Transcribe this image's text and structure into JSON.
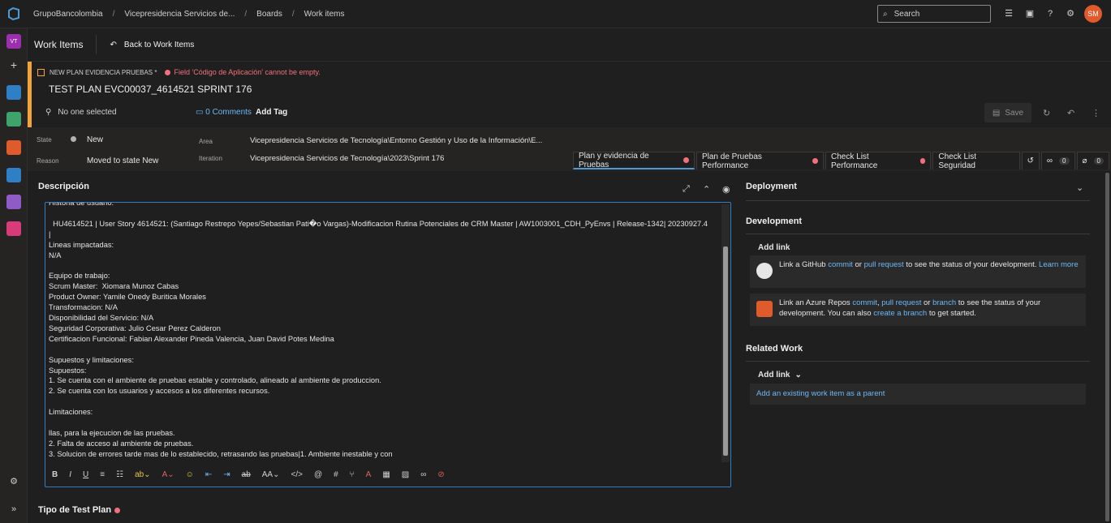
{
  "topbar": {
    "breadcrumbs": [
      "GrupoBancolombia",
      "Vicepresidencia Servicios de...",
      "Boards",
      "Work items"
    ],
    "search_placeholder": "Search",
    "avatar_initials": "SM"
  },
  "leftnav": {
    "project_initials": "VT"
  },
  "header": {
    "title": "Work Items",
    "back_label": "Back to Work Items"
  },
  "workitem": {
    "type_label": "NEW PLAN EVIDENCIA PRUEBAS *",
    "error": "Field 'Código de Aplicación' cannot be empty.",
    "title": "TEST PLAN EVC00037_4614521 SPRINT 176",
    "assigned": "No one selected",
    "comments": "0 Comments",
    "add_tag": "Add Tag",
    "save": "Save"
  },
  "fields": {
    "state_label": "State",
    "state_value": "New",
    "reason_label": "Reason",
    "reason_value": "Moved to state New",
    "area_label": "Area",
    "area_value": "Vicepresidencia Servicios de Tecnología\\Entorno Gestión y Uso de la Información\\E...",
    "iteration_label": "Iteration",
    "iteration_value": "Vicepresidencia Servicios de Tecnología\\2023\\Sprint 176"
  },
  "tabs": [
    {
      "label": "Plan y evidencia de Pruebas"
    },
    {
      "label": "Plan de Pruebas Performance"
    },
    {
      "label": "Check List Performance"
    },
    {
      "label": "Check List Seguridad"
    }
  ],
  "tab_counts": {
    "links": "0",
    "attachments": "0"
  },
  "description": {
    "header": "Descripción",
    "lines": [
      "Historia de usuario:",
      "",
      "  HU4614521 | User Story 4614521: (Santiago Restrepo Yepes/Sebastian Pati�o Vargas)-Modificacion Rutina Potenciales de CRM Master | AW1003001_CDH_PyEnvs | Release-1342| 20230927.4",
      "|",
      "Lineas impactadas:",
      "N/A",
      "",
      "Equipo de trabajo:",
      "Scrum Master:  Xiomara Munoz Cabas",
      "Product Owner: Yamile Onedy Buritica Morales",
      "Transformacion: N/A",
      "Disponibilidad del Servicio: N/A",
      "Seguridad Corporativa: Julio Cesar Perez Calderon",
      "Certificacion Funcional: Fabian Alexander Pineda Valencia, Juan David Potes Medina",
      "",
      "Supuestos y limitaciones:",
      "Supuestos:",
      "1. Se cuenta con el ambiente de pruebas estable y controlado, alineado al ambiente de produccion.",
      "2. Se cuenta con los usuarios y accesos a los diferentes recursos.",
      "",
      "Limitaciones:",
      "",
      "llas, para la ejecucion de las pruebas.",
      "2. Falta de acceso al ambiente de pruebas.",
      "3. Solucion de errores tarde mas de lo establecido, retrasando las pruebas|1. Ambiente inestable y con"
    ]
  },
  "test_plan_header": "Tipo de Test Plan",
  "deployment": {
    "header": "Deployment"
  },
  "development": {
    "header": "Development",
    "add_link": "Add link",
    "github_pre": "Link a GitHub ",
    "github_commit": "commit",
    "github_or": " or ",
    "github_pr": "pull request",
    "github_post": " to see the status of your development. ",
    "github_learn": "Learn more",
    "azure_pre": "Link an Azure Repos ",
    "azure_commit": "commit",
    "azure_sep": ", ",
    "azure_pr": "pull request",
    "azure_or": " or ",
    "azure_branch": "branch",
    "azure_mid": " to see the status of your development. You can also ",
    "azure_create": "create a branch",
    "azure_post": " to get started."
  },
  "related": {
    "header": "Related Work",
    "add_link": "Add link",
    "parent_link": "Add an existing work item as a parent"
  }
}
